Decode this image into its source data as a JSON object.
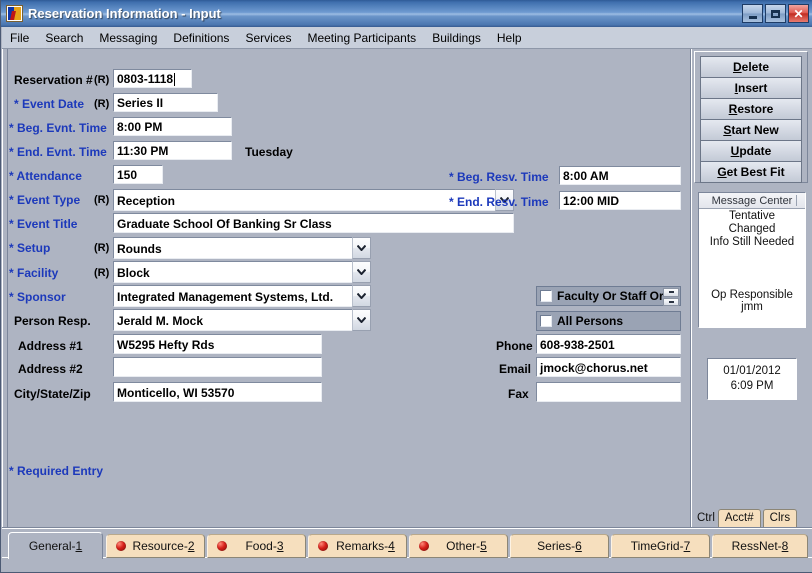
{
  "window": {
    "title": "Reservation Information - Input",
    "app_icon": "reservation-app-icon",
    "minimize_label": "_",
    "maximize_label": "□",
    "close_label": "✕"
  },
  "menubar": {
    "items": [
      {
        "label": "File"
      },
      {
        "label": "Search"
      },
      {
        "label": "Messaging"
      },
      {
        "label": "Definitions"
      },
      {
        "label": "Services"
      },
      {
        "label": "Meeting Participants"
      },
      {
        "label": "Buildings"
      },
      {
        "label": "Help"
      }
    ]
  },
  "form": {
    "reservation_number": {
      "label": "Reservation #",
      "rtag": "(R)",
      "value": "0803-1118"
    },
    "event_date": {
      "label": "* Event Date",
      "rtag": "(R)",
      "value": "Series II",
      "day": "Tuesday"
    },
    "beg_evnt_time": {
      "label": "* Beg. Evnt. Time",
      "value": "8:00 PM"
    },
    "end_evnt_time": {
      "label": "* End. Evnt. Time",
      "value": "11:30 PM"
    },
    "attendance": {
      "label": "* Attendance",
      "value": "150"
    },
    "event_type": {
      "label": "* Event Type",
      "rtag": "(R)",
      "value": "Reception"
    },
    "event_title": {
      "label": "* Event Title",
      "value": "Graduate School Of Banking Sr Class"
    },
    "setup": {
      "label": "* Setup",
      "rtag": "(R)",
      "value": "Rounds"
    },
    "facility": {
      "label": "* Facility",
      "rtag": "(R)",
      "value": "Block"
    },
    "sponsor": {
      "label": "* Sponsor",
      "value": "Integrated Management Systems, Ltd."
    },
    "person_resp": {
      "label": "Person Resp.",
      "value": "Jerald M. Mock"
    },
    "address1": {
      "label": "Address #1",
      "value": "W5295 Hefty Rds"
    },
    "address2": {
      "label": "Address #2",
      "value": ""
    },
    "city_state_zip": {
      "label": "City/State/Zip",
      "value": "Monticello, WI  53570"
    },
    "beg_resv_time": {
      "label": "* Beg. Resv. Time",
      "value": "8:00 AM"
    },
    "end_resv_time": {
      "label": "* End. Resv. Time",
      "value": "12:00 MID"
    },
    "faculty_or_staff_org": {
      "label": "Faculty Or Staff Org",
      "checked": false
    },
    "all_persons": {
      "label": "All Persons",
      "checked": false
    },
    "phone": {
      "label": "Phone",
      "value": "608-938-2501"
    },
    "email": {
      "label": "Email",
      "value": "jmock@chorus.net"
    },
    "fax": {
      "label": "Fax",
      "value": ""
    },
    "required_note": "* Required Entry"
  },
  "actions": [
    {
      "accel": "D",
      "rest": "elete",
      "name": "delete"
    },
    {
      "accel": "I",
      "rest": "nsert",
      "name": "insert"
    },
    {
      "accel": "R",
      "rest": "estore",
      "name": "restore"
    },
    {
      "accel": "S",
      "rest": "tart New",
      "name": "start-new"
    },
    {
      "accel": "U",
      "rest": "pdate",
      "name": "update"
    },
    {
      "accel": "G",
      "rest": "et Best Fit",
      "name": "get-best-fit"
    }
  ],
  "message_center": {
    "header": "Message Center",
    "messages": [
      "Tentative",
      "Changed",
      "Info Still Needed"
    ],
    "operator": "Op Responsible jmm"
  },
  "clock": {
    "date": "01/01/2012",
    "time": "6:09 PM"
  },
  "mini_tabs": {
    "ctrl_label": "Ctrl",
    "tabs": [
      {
        "label": "Acct#"
      },
      {
        "label": "Clrs"
      }
    ]
  },
  "bottom_tabs": [
    {
      "text": "General-",
      "num": "1",
      "dot": false,
      "active": true,
      "name": "general"
    },
    {
      "text": "Resource-",
      "num": "2",
      "dot": true,
      "active": false,
      "name": "resource"
    },
    {
      "text": "Food-",
      "num": "3",
      "dot": true,
      "active": false,
      "name": "food"
    },
    {
      "text": "Remarks-",
      "num": "4",
      "dot": true,
      "active": false,
      "name": "remarks"
    },
    {
      "text": "Other-",
      "num": "5",
      "dot": true,
      "active": false,
      "name": "other"
    },
    {
      "text": "Series-",
      "num": "6",
      "dot": false,
      "active": false,
      "name": "series"
    },
    {
      "text": "TimeGrid-",
      "num": "7",
      "dot": false,
      "active": false,
      "name": "timegrid"
    },
    {
      "text": "RessNet-",
      "num": "8",
      "dot": false,
      "active": false,
      "name": "ressnet"
    }
  ],
  "colors": {
    "window_bg": "#aeb4c2",
    "title_accent": "#3f6fae",
    "required_label": "#1c39bb",
    "tab_inactive": "#f6dfbe",
    "dot_red": "#d6201a",
    "field_bg": "#ffffff"
  }
}
